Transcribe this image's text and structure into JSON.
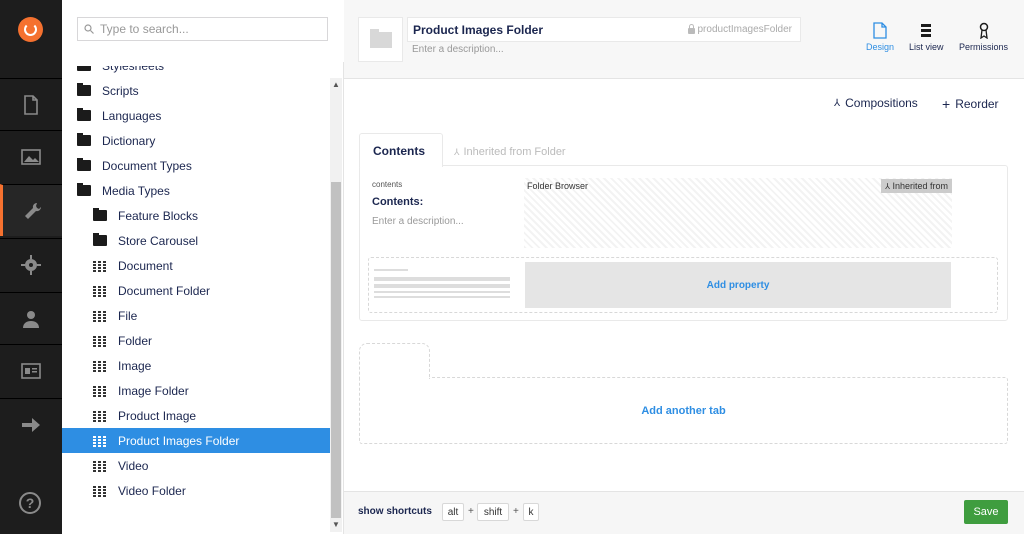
{
  "search": {
    "placeholder": "Type to search..."
  },
  "tree": {
    "items": [
      {
        "label": "Stylesheets",
        "type": "folder",
        "level": 0
      },
      {
        "label": "Scripts",
        "type": "folder",
        "level": 0
      },
      {
        "label": "Languages",
        "type": "folder",
        "level": 0
      },
      {
        "label": "Dictionary",
        "type": "folder",
        "level": 0
      },
      {
        "label": "Document Types",
        "type": "folder",
        "level": 0
      },
      {
        "label": "Media Types",
        "type": "folder",
        "level": 0
      },
      {
        "label": "Feature Blocks",
        "type": "folder",
        "level": 1
      },
      {
        "label": "Store Carousel",
        "type": "folder",
        "level": 1
      },
      {
        "label": "Document",
        "type": "mediatype",
        "level": 1
      },
      {
        "label": "Document Folder",
        "type": "mediatype",
        "level": 1
      },
      {
        "label": "File",
        "type": "mediatype",
        "level": 1
      },
      {
        "label": "Folder",
        "type": "mediatype",
        "level": 1
      },
      {
        "label": "Image",
        "type": "mediatype",
        "level": 1
      },
      {
        "label": "Image Folder",
        "type": "mediatype",
        "level": 1
      },
      {
        "label": "Product Image",
        "type": "mediatype",
        "level": 1
      },
      {
        "label": "Product Images Folder",
        "type": "mediatype",
        "level": 1,
        "selected": true
      },
      {
        "label": "Video",
        "type": "mediatype",
        "level": 1
      },
      {
        "label": "Video Folder",
        "type": "mediatype",
        "level": 1
      }
    ]
  },
  "header": {
    "name": "Product Images Folder",
    "alias": "productImagesFolder",
    "description_placeholder": "Enter a description...",
    "buttons": {
      "design": "Design",
      "list_view": "List view",
      "permissions": "Permissions"
    }
  },
  "toolbar": {
    "compositions": "Compositions",
    "reorder": "Reorder"
  },
  "tabs": {
    "contents": "Contents",
    "inherited": "Inherited from Folder"
  },
  "property": {
    "alias": "contents",
    "label": "Contents:",
    "description": "Enter a description...",
    "editor": "Folder Browser",
    "inherited_badge": "Inherited from"
  },
  "actions": {
    "add_property": "Add property",
    "add_tab": "Add another tab"
  },
  "footer": {
    "shortcuts_label": "show shortcuts",
    "keys": [
      "alt",
      "shift",
      "k"
    ],
    "plus": "+",
    "save": "Save"
  },
  "help": "?",
  "colors": {
    "accent": "#2e8ee3",
    "brand": "#f5712f",
    "save": "#3f9d3f",
    "sidebar": "#1d1d1d"
  }
}
